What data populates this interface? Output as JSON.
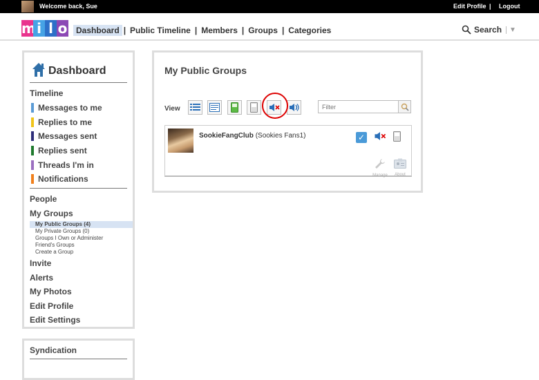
{
  "topbar": {
    "welcome": "Welcome back, Sue",
    "edit_profile": "Edit Profile",
    "separator": "|",
    "logout": "Logout"
  },
  "logo": {
    "letters": [
      "m",
      "i",
      "l",
      "o"
    ],
    "colors": [
      "#e9338d",
      "#46a3e5",
      "#2d70c8",
      "#8c48b5"
    ]
  },
  "nav": {
    "items": [
      "Dashboard",
      "Public Timeline",
      "Members",
      "Groups",
      "Categories"
    ],
    "active": "Dashboard",
    "search": "Search"
  },
  "sidebar": {
    "title": "Dashboard",
    "timeline": "Timeline",
    "timeline_items": [
      {
        "label": "Messages to me",
        "color": "#5b9bd5"
      },
      {
        "label": "Replies to me",
        "color": "#f0c419"
      },
      {
        "label": "Messages sent",
        "color": "#2e2e7a"
      },
      {
        "label": "Replies sent",
        "color": "#1f7a2e"
      },
      {
        "label": "Threads I'm in",
        "color": "#9b6fc0"
      },
      {
        "label": "Notifications",
        "color": "#f07f1b"
      }
    ],
    "people": "People",
    "my_groups": "My Groups",
    "group_links": [
      "My Public Groups (4)",
      "My Private Groups (0)",
      "Groups I Own or Administer",
      "Friend's Groups",
      "Create a Group"
    ],
    "after_links": [
      "Invite",
      "Alerts",
      "My Photos",
      "Edit Profile",
      "Edit Settings"
    ]
  },
  "syndication": {
    "title": "Syndication"
  },
  "main": {
    "title": "My Public Groups",
    "view_label": "View",
    "filter_placeholder": "Filter",
    "group": {
      "name": "SookieFangClub",
      "alias": "(Sookies Fans1)",
      "manage": "Manage",
      "about": "About"
    }
  }
}
